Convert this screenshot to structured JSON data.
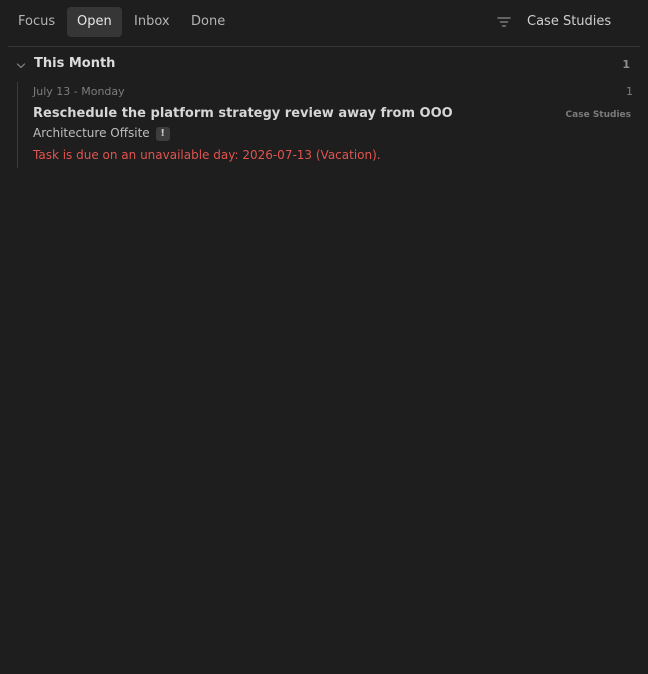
{
  "topbar": {
    "tabs": [
      {
        "label": "Focus",
        "active": false
      },
      {
        "label": "Open",
        "active": true
      },
      {
        "label": "Inbox",
        "active": false
      },
      {
        "label": "Done",
        "active": false
      }
    ],
    "filter_icon": "filter-icon",
    "project_filter": "Case Studies"
  },
  "group": {
    "title": "This Month",
    "count": "1",
    "chevron_icon": "chevron-down-icon"
  },
  "day": {
    "label": "July 13 - Monday",
    "count": "1"
  },
  "task": {
    "title": "Reschedule the platform strategy review away from OOO",
    "project": "Case Studies",
    "area": "Architecture Offsite",
    "priority": "!",
    "warning": "Task is due on an unavailable day: 2026-07-13 (Vacation)."
  },
  "colors": {
    "background": "#1e1e1e",
    "active_tab": "#363636",
    "warning": "#e0534f"
  }
}
